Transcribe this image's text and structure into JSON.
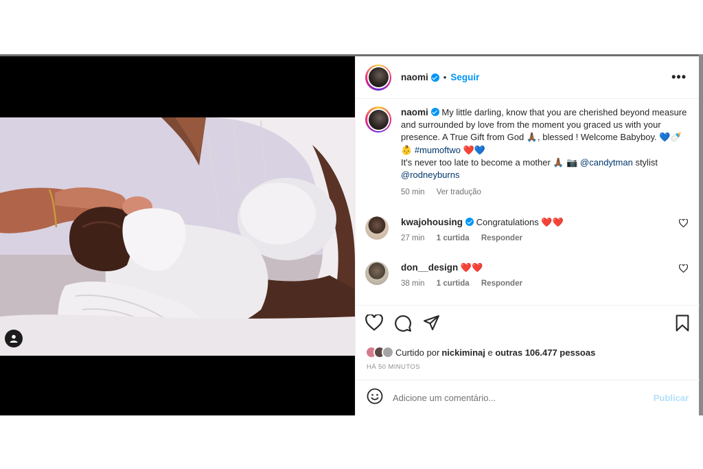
{
  "post": {
    "author": "naomi",
    "follow_label": "Seguir",
    "dot": "•",
    "more": "•••"
  },
  "caption": {
    "author": "naomi",
    "line1": "My little darling, know that you are cherished beyond measure and surrounded by love from the moment you graced us with your presence. A True Gift from God 🙏🏾, blessed ! Welcome Babyboy. 💙🍼👶 ",
    "hashtag": "#mumoftwo",
    "line1_end": " ❤️💙",
    "line2": "It's never too late to become a mother 🙏🏾 📷 ",
    "mention1": "@candytman",
    "line3": " stylist ",
    "mention2": "@rodneyburns",
    "time": "50 min",
    "translate": "Ver tradução"
  },
  "comments": [
    {
      "user": "kwajohousing",
      "text": "Congratulations ❤️❤️",
      "time": "27 min",
      "likes": "1 curtida",
      "reply": "Responder"
    },
    {
      "user": "don__design",
      "text": "❤️❤️",
      "time": "38 min",
      "likes": "1 curtida",
      "reply": "Responder"
    }
  ],
  "likes": {
    "prefix": "Curtido por ",
    "user": "nickiminaj",
    "mid": " e ",
    "others": "outras 106.477 pessoas"
  },
  "time_ago": "HÁ 50 MINUTOS",
  "add_comment": {
    "placeholder": "Adicione um comentário...",
    "publish": "Publicar"
  },
  "colors": {
    "accent": "#0095f6",
    "link": "#00376b",
    "publish_disabled": "#b2dffc"
  },
  "icons": [
    "ellipsis-icon",
    "heart-icon",
    "comment-icon",
    "share-icon",
    "bookmark-icon",
    "emoji-icon",
    "user-tag-icon",
    "verified-icon"
  ]
}
